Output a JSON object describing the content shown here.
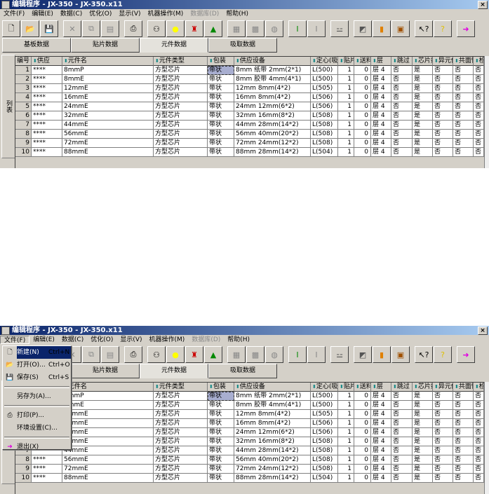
{
  "window": {
    "title": "编辑程序 - JX-350 - JX-350.x11",
    "close": "×"
  },
  "menubar": [
    {
      "label": "文件(F)"
    },
    {
      "label": "编辑(E)"
    },
    {
      "label": "数据(C)"
    },
    {
      "label": "优化(O)"
    },
    {
      "label": "显示(V)"
    },
    {
      "label": "机器操作(M)"
    },
    {
      "label": "数据库(D)",
      "disabled": true
    },
    {
      "label": "帮助(H)"
    }
  ],
  "toolbar": [
    {
      "name": "new-icon",
      "glyph": "🗋",
      "color": "#000"
    },
    {
      "name": "open-icon",
      "glyph": "📂",
      "color": "#c8a000"
    },
    {
      "name": "save-icon",
      "glyph": "💾",
      "color": "#000"
    },
    {
      "name": "cut-icon",
      "glyph": "✕",
      "color": "#888",
      "gap": true
    },
    {
      "name": "copy-icon",
      "glyph": "⧉",
      "color": "#888"
    },
    {
      "name": "paste-icon",
      "glyph": "▤",
      "color": "#888"
    },
    {
      "name": "print-icon",
      "glyph": "⎙",
      "color": "#000",
      "gap": true
    },
    {
      "name": "find-icon",
      "glyph": "⚇",
      "color": "#000",
      "gap": true
    },
    {
      "name": "bulb-icon",
      "glyph": "●",
      "color": "#ffff00"
    },
    {
      "name": "optimize-icon",
      "glyph": "♜",
      "color": "#c00"
    },
    {
      "name": "shapes-icon",
      "glyph": "▲",
      "color": "#080"
    },
    {
      "name": "edit-grey-icon",
      "glyph": "▦",
      "color": "#888",
      "gap": true
    },
    {
      "name": "machine-grey-icon",
      "glyph": "▩",
      "color": "#888"
    },
    {
      "name": "nozzle-grey-icon",
      "glyph": "◍",
      "color": "#888"
    },
    {
      "name": "align-icon",
      "glyph": "Ⅰ",
      "color": "#080",
      "gap": true
    },
    {
      "name": "align-grey-icon",
      "glyph": "Ⅰ",
      "color": "#888"
    },
    {
      "name": "group-icon",
      "glyph": "⚍",
      "color": "#555",
      "gap": true
    },
    {
      "name": "layer-icon",
      "glyph": "◩",
      "color": "#555",
      "gap": true
    },
    {
      "name": "orange-bar-icon",
      "glyph": "▮",
      "color": "#e08000"
    },
    {
      "name": "copy-block-icon",
      "glyph": "▣",
      "color": "#a05000"
    },
    {
      "name": "context-help-icon",
      "glyph": "↖?",
      "color": "#000",
      "gap": true
    },
    {
      "name": "help-icon",
      "glyph": "?",
      "color": "#e0c000"
    },
    {
      "name": "exit-icon",
      "glyph": "➜",
      "color": "#e000e0",
      "gap": true
    }
  ],
  "tabs": [
    {
      "label": "基板数据"
    },
    {
      "label": "贴片数据"
    },
    {
      "label": "元件数据",
      "active": true
    },
    {
      "label": "吸取数据"
    }
  ],
  "side_label": "列表",
  "table": {
    "columns": [
      "编号",
      "供应",
      "元件名",
      "元件类型",
      "包装",
      "供应设备",
      "定心(吸)",
      "贴片",
      "送料",
      "层",
      "跳过",
      "芯片数",
      "异元件",
      "共面性",
      "检"
    ],
    "rows": [
      [
        "1",
        "****",
        "8mmP",
        "方型芯片",
        "带状",
        "8mm 纸带 2mm(2*1)",
        "L(500)",
        "1",
        "0",
        "层 4",
        "否",
        "是",
        "否",
        "否",
        "否"
      ],
      [
        "2",
        "****",
        "8mmE",
        "方型芯片",
        "带状",
        "8mm 胶带 4mm(4*1)",
        "L(500)",
        "1",
        "0",
        "层 4",
        "否",
        "是",
        "否",
        "否",
        "否"
      ],
      [
        "3",
        "****",
        "12mmE",
        "方型芯片",
        "带状",
        "12mm 8mm(4*2)",
        "L(505)",
        "1",
        "0",
        "层 4",
        "否",
        "是",
        "否",
        "否",
        "否"
      ],
      [
        "4",
        "****",
        "16mmE",
        "方型芯片",
        "带状",
        "16mm 8mm(4*2)",
        "L(506)",
        "1",
        "0",
        "层 4",
        "否",
        "是",
        "否",
        "否",
        "否"
      ],
      [
        "5",
        "****",
        "24mmE",
        "方型芯片",
        "带状",
        "24mm 12mm(6*2)",
        "L(506)",
        "1",
        "0",
        "层 4",
        "否",
        "是",
        "否",
        "否",
        "否"
      ],
      [
        "6",
        "****",
        "32mmE",
        "方型芯片",
        "带状",
        "32mm 16mm(8*2)",
        "L(508)",
        "1",
        "0",
        "层 4",
        "否",
        "是",
        "否",
        "否",
        "否"
      ],
      [
        "7",
        "****",
        "44mmE",
        "方型芯片",
        "带状",
        "44mm 28mm(14*2)",
        "L(508)",
        "1",
        "0",
        "层 4",
        "否",
        "是",
        "否",
        "否",
        "否"
      ],
      [
        "8",
        "****",
        "56mmE",
        "方型芯片",
        "带状",
        "56mm 40mm(20*2)",
        "L(508)",
        "1",
        "0",
        "层 4",
        "否",
        "是",
        "否",
        "否",
        "否"
      ],
      [
        "9",
        "****",
        "72mmE",
        "方型芯片",
        "带状",
        "72mm 24mm(12*2)",
        "L(508)",
        "1",
        "0",
        "层 4",
        "否",
        "是",
        "否",
        "否",
        "否"
      ],
      [
        "10",
        "****",
        "88mmE",
        "方型芯片",
        "带状",
        "88mm 28mm(14*2)",
        "L(504)",
        "1",
        "0",
        "层 4",
        "否",
        "是",
        "否",
        "否",
        "否"
      ]
    ]
  },
  "file_menu": [
    {
      "label": "新建(N)",
      "shortcut": "Ctrl+N",
      "icon": "new-icon",
      "glyph": "🗋",
      "highlight": true
    },
    {
      "label": "打开(O)...",
      "shortcut": "Ctrl+O",
      "icon": "open-icon",
      "glyph": "📂"
    },
    {
      "label": "保存(S)",
      "shortcut": "Ctrl+S",
      "icon": "save-icon",
      "glyph": "💾"
    },
    {
      "sep": true
    },
    {
      "label": "另存为(A)..."
    },
    {
      "sep": true
    },
    {
      "label": "打印(P)...",
      "icon": "print-icon",
      "glyph": "⎙"
    },
    {
      "label": "环境设置(C)..."
    },
    {
      "sep": true
    },
    {
      "label": "退出(X)",
      "icon": "exit-icon",
      "glyph": "➜"
    }
  ]
}
